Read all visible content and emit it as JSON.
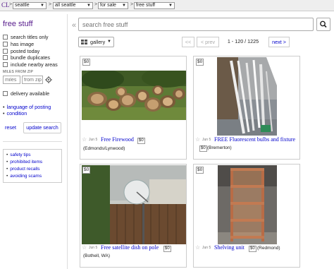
{
  "topbar": {
    "logo": "CL",
    "crumbs": [
      "seattle",
      "all seattle",
      "for sale",
      "free stuff"
    ],
    "separator": ">"
  },
  "sidebar": {
    "title": "free stuff",
    "filters": [
      "search titles only",
      "has image",
      "posted today",
      "bundle duplicates",
      "include nearby areas"
    ],
    "miles_label": "MILES FROM ZIP",
    "miles_placeholder": "miles",
    "zip_placeholder": "from zip",
    "delivery_label": "delivery available",
    "links": [
      "language of posting",
      "condition"
    ],
    "reset_label": "reset",
    "update_label": "update search",
    "help_links": [
      "safety tips",
      "prohibited items",
      "product recalls",
      "avoiding scams"
    ]
  },
  "search": {
    "placeholder": "search free stuff"
  },
  "toolbar": {
    "view_label": "gallery",
    "first_label": "<<",
    "prev_label": "< prev",
    "range_label": "1 - 120 / 1225",
    "next_label": "next >"
  },
  "listings": [
    {
      "price": "$0",
      "date": "Jun 5",
      "title": "Free Firewood",
      "hood": "(Edmonds/Lynwood)"
    },
    {
      "price": "$0",
      "date": "Jun 5",
      "title": "FREE Fluorescent bulbs and fixture",
      "hood": "(Bremerton)"
    },
    {
      "price": "$0",
      "date": "Jun 5",
      "title": "Free satellite dish on pole",
      "hood": "(Bothell, WA)"
    },
    {
      "price": "$0",
      "date": "Jun 5",
      "title": "Shelving unit",
      "hood": "(Redmond)"
    }
  ],
  "colors": {
    "link": "#0000cc",
    "visited": "#551a8b"
  }
}
